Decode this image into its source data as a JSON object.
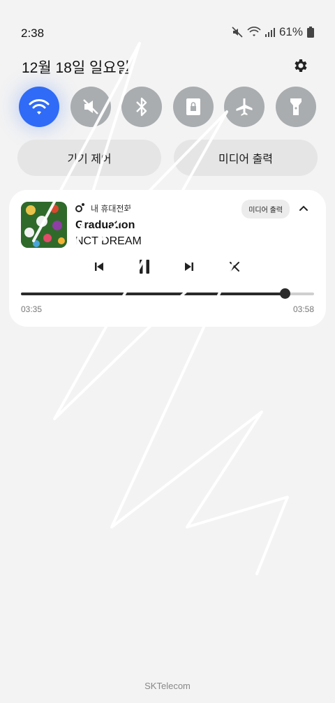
{
  "status_bar": {
    "time": "2:38",
    "battery_text": "61%"
  },
  "header": {
    "date": "12월 18일 일요일"
  },
  "quick_tiles": [
    {
      "name": "wifi",
      "icon": "wifi-icon",
      "active": true
    },
    {
      "name": "sound",
      "icon": "mute-icon",
      "active": false
    },
    {
      "name": "bluetooth",
      "icon": "bluetooth-icon",
      "active": false
    },
    {
      "name": "rotation-lock",
      "icon": "lock-rotation-icon",
      "active": false
    },
    {
      "name": "airplane",
      "icon": "airplane-icon",
      "active": false
    },
    {
      "name": "flashlight",
      "icon": "flashlight-icon",
      "active": false
    }
  ],
  "pills": {
    "device_control": "기기 제어",
    "media_output": "미디어 출력"
  },
  "media": {
    "app_name": "내 휴대전화",
    "output_chip": "미디어 출력",
    "title": "Graduation",
    "artist": "NCT DREAM",
    "elapsed": "03:35",
    "duration": "03:58",
    "progress": 0.9
  },
  "footer": {
    "carrier": "SKTelecom"
  },
  "colors": {
    "background": "#f3f3f3",
    "accent": "#2f6bf6",
    "tile_inactive": "#a9adb0",
    "pill": "#e5e5e5",
    "card": "#ffffff"
  }
}
